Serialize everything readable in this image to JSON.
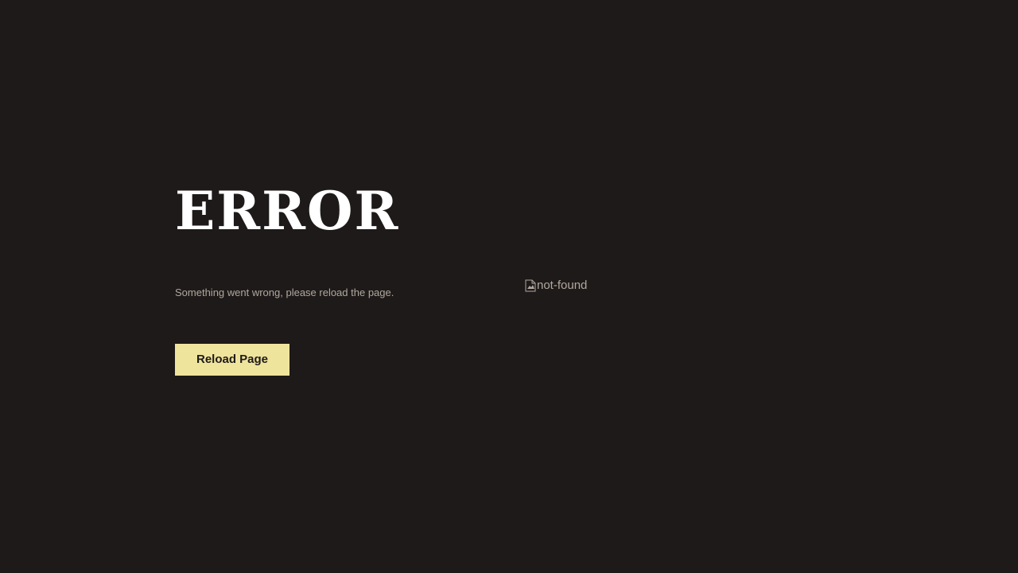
{
  "error": {
    "title": "ERROR",
    "message": "Something went wrong, please reload the page.",
    "button_label": "Reload Page",
    "image_alt": "not-found",
    "image_icon": "broken-image-icon"
  },
  "colors": {
    "background": "#1e1a19",
    "title": "#ffffff",
    "muted_text": "#b0a89f",
    "button_background": "#efe49b",
    "button_text": "#1e1a19"
  }
}
